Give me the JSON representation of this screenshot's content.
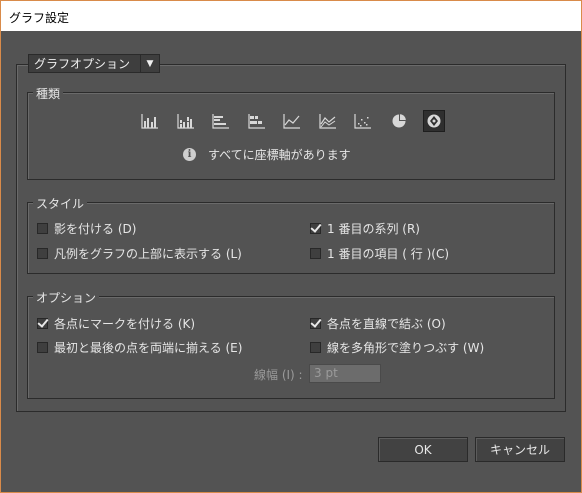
{
  "window": {
    "title": "グラフ設定"
  },
  "dropdown": {
    "label": "グラフオプション"
  },
  "types": {
    "label": "種類",
    "buttons": [
      {
        "name": "grouped-column-graph-icon"
      },
      {
        "name": "stacked-column-graph-icon"
      },
      {
        "name": "grouped-bar-graph-icon"
      },
      {
        "name": "stacked-bar-graph-icon"
      },
      {
        "name": "line-graph-icon"
      },
      {
        "name": "area-graph-icon"
      },
      {
        "name": "scatter-graph-icon"
      },
      {
        "name": "pie-graph-icon"
      },
      {
        "name": "radar-graph-icon",
        "selected": true
      }
    ],
    "info": "すべてに座標軸があります"
  },
  "style": {
    "label": "スタイル",
    "shadow": "影を付ける (D)",
    "legend_top": "凡例をグラフの上部に表示する (L)",
    "first_series": "1 番目の系列 (R)",
    "first_item": "1 番目の項目 ( 行 )(C)"
  },
  "options": {
    "label": "オプション",
    "mark_points": "各点にマークを付ける (K)",
    "connect_lines": "各点を直線で結ぶ (O)",
    "fill_polygon": "線を多角形で塗りつぶす (W)",
    "align_endpoints": "最初と最後の点を両端に揃える (E)",
    "line_width_label": "線幅 (I) :",
    "line_width_value": "3 pt"
  },
  "buttons": {
    "ok": "OK",
    "cancel": "キャンセル"
  }
}
